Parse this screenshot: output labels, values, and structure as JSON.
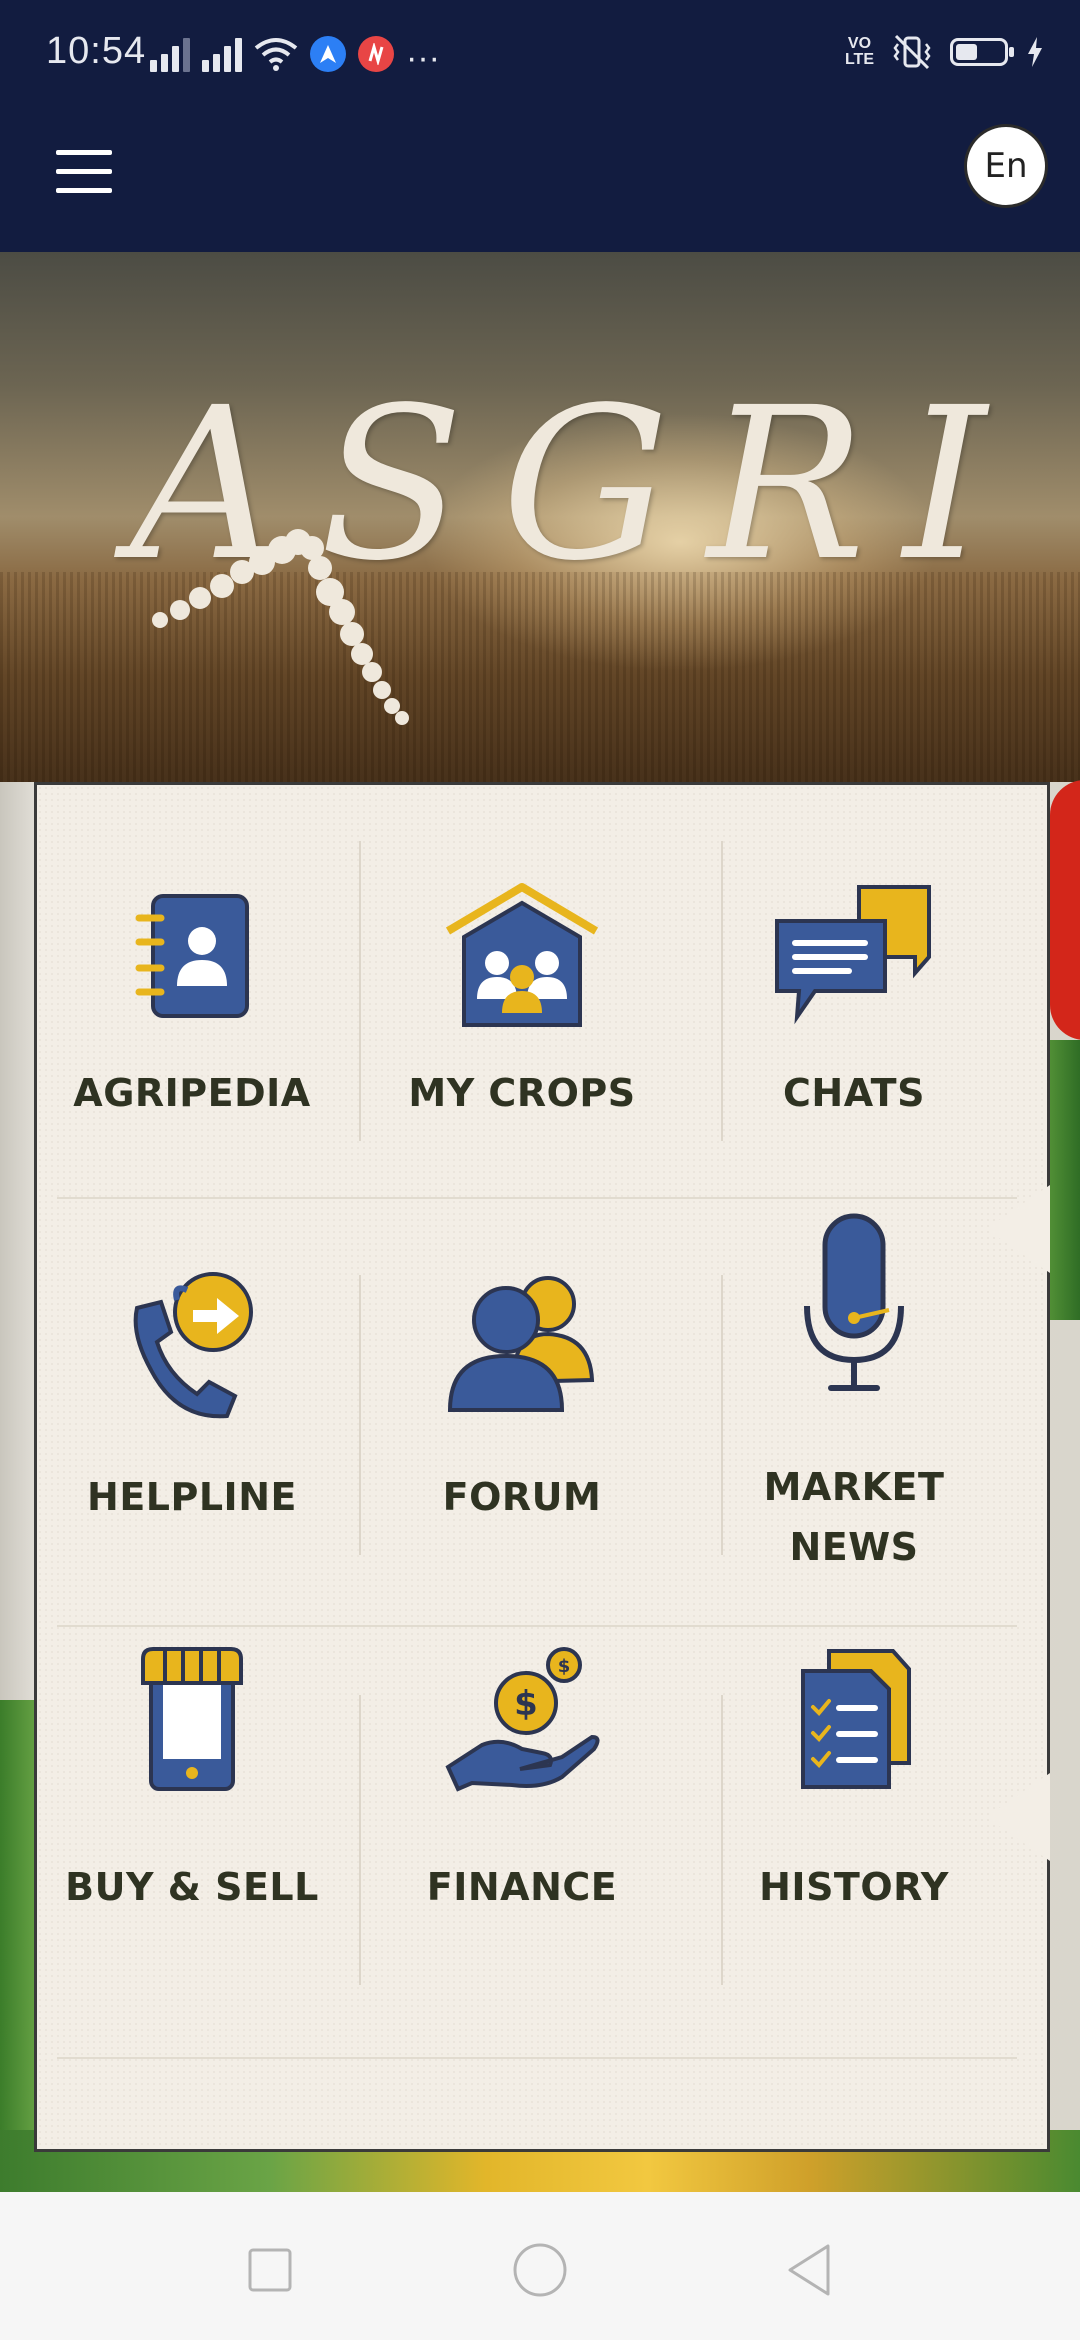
{
  "status_bar": {
    "time": "10:54",
    "more": "···",
    "volte": [
      "VO",
      "LTE"
    ]
  },
  "header": {
    "language_label": "En"
  },
  "hero": {
    "logo_text": "ASGRI"
  },
  "menu": {
    "items": [
      {
        "label": "AGRIPEDIA",
        "icon": "contact-book-icon"
      },
      {
        "label": "MY CROPS",
        "icon": "farm-house-icon"
      },
      {
        "label": "CHATS",
        "icon": "chat-bubbles-icon"
      },
      {
        "label": "HELPLINE",
        "icon": "phone-helpline-icon"
      },
      {
        "label": "FORUM",
        "icon": "users-icon"
      },
      {
        "label": "MARKET NEWS",
        "icon": "microphone-icon"
      },
      {
        "label": "BUY & SELL",
        "icon": "mobile-shop-icon"
      },
      {
        "label": "FINANCE",
        "icon": "money-hand-icon"
      },
      {
        "label": "HISTORY",
        "icon": "checklist-icon"
      }
    ]
  },
  "colors": {
    "header_bg": "#121c40",
    "icon_blue": "#3a5a9a",
    "icon_yellow": "#e8b51d",
    "label_text": "#2f3322"
  }
}
